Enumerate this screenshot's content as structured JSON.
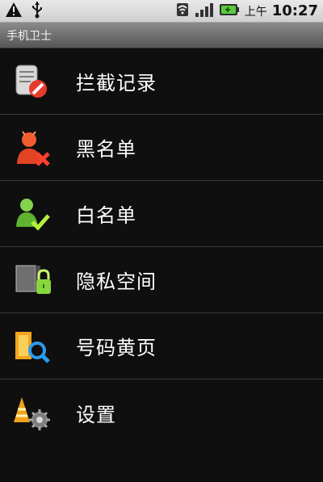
{
  "status_bar": {
    "time_prefix": "上午",
    "time": "10:27",
    "icons": [
      "warning-icon",
      "usb-icon",
      "wifi-icon",
      "signal-icon",
      "battery-icon"
    ]
  },
  "app": {
    "title": "手机卫士"
  },
  "menu": {
    "items": [
      {
        "label": "拦截记录",
        "icon": "block-log-icon"
      },
      {
        "label": "黑名单",
        "icon": "blacklist-icon"
      },
      {
        "label": "白名单",
        "icon": "whitelist-icon"
      },
      {
        "label": "隐私空间",
        "icon": "privacy-lock-icon"
      },
      {
        "label": "号码黄页",
        "icon": "yellow-pages-icon"
      },
      {
        "label": "设置",
        "icon": "settings-icon"
      }
    ]
  },
  "colors": {
    "background": "#0f0f0f",
    "divider": "#3a3a3a",
    "title_bar": "#6b6b6b"
  }
}
